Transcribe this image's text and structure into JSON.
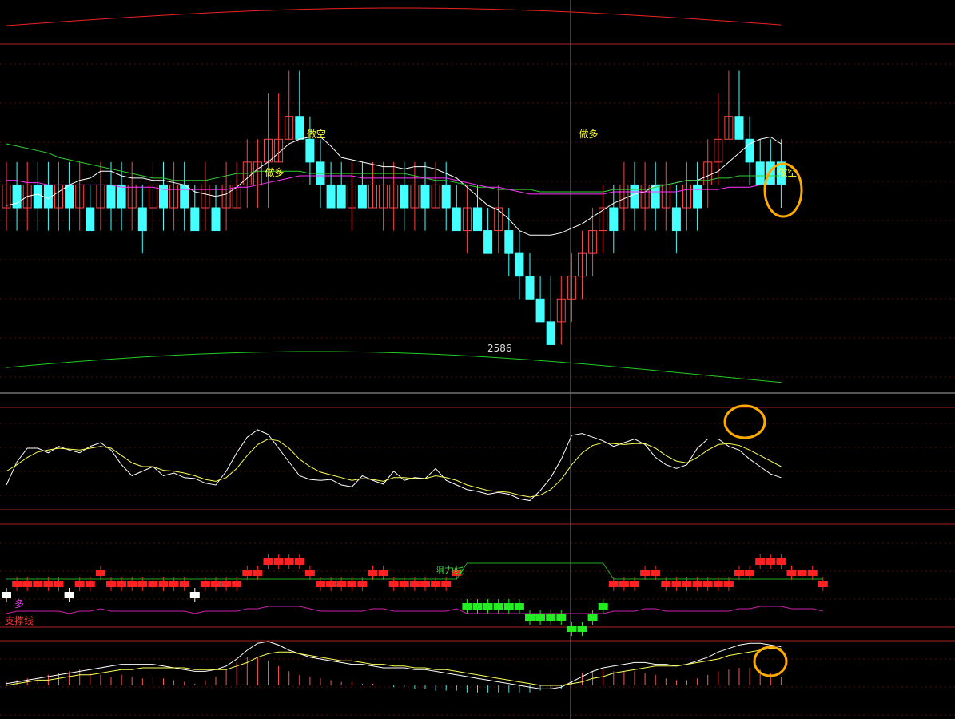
{
  "chart_data": [
    {
      "type": "candlestick",
      "panel": "main",
      "annotations": {
        "low_label": "2586",
        "signals": [
          {
            "text": "做空",
            "bar": 29
          },
          {
            "text": "做多",
            "bar": 25
          },
          {
            "text": "做多",
            "bar": 55
          },
          {
            "text": "做空",
            "bar": 74
          }
        ]
      },
      "candles": [
        [
          3,
          4,
          5,
          2
        ],
        [
          4,
          3,
          5,
          2
        ],
        [
          3,
          4,
          5,
          2
        ],
        [
          4,
          3,
          5,
          2
        ],
        [
          4,
          3,
          5,
          2
        ],
        [
          3,
          4,
          5,
          2
        ],
        [
          4,
          3,
          5,
          2
        ],
        [
          3,
          4,
          5,
          2
        ],
        [
          3,
          2,
          4,
          2
        ],
        [
          3,
          4,
          5,
          2
        ],
        [
          4,
          3,
          5,
          2
        ],
        [
          4,
          3,
          5,
          2
        ],
        [
          3,
          4,
          5,
          2
        ],
        [
          3,
          2,
          4,
          1
        ],
        [
          3,
          4,
          5,
          2
        ],
        [
          4,
          3,
          5,
          2
        ],
        [
          3,
          4,
          5,
          2
        ],
        [
          4,
          3,
          5,
          2
        ],
        [
          3,
          2,
          4,
          2
        ],
        [
          3,
          4,
          5,
          2
        ],
        [
          3,
          2,
          4,
          2
        ],
        [
          3,
          4,
          5,
          2
        ],
        [
          3,
          4,
          5,
          3
        ],
        [
          4,
          5,
          6,
          3
        ],
        [
          4,
          5,
          6,
          3
        ],
        [
          5,
          6,
          8,
          3
        ],
        [
          5,
          6,
          8,
          5
        ],
        [
          6,
          7,
          9,
          6
        ],
        [
          7,
          6,
          9,
          6
        ],
        [
          6,
          5,
          7,
          4
        ],
        [
          5,
          4,
          6,
          3
        ],
        [
          4,
          3,
          5,
          3
        ],
        [
          4,
          3,
          5,
          3
        ],
        [
          3,
          4,
          5,
          2
        ],
        [
          4,
          3,
          5,
          3
        ],
        [
          3,
          4,
          5,
          3
        ],
        [
          3,
          4,
          5,
          2
        ],
        [
          3,
          4,
          5,
          2
        ],
        [
          4,
          3,
          5,
          2
        ],
        [
          3,
          4,
          5,
          2
        ],
        [
          4,
          3,
          5,
          2
        ],
        [
          3,
          4,
          5,
          3
        ],
        [
          4,
          3,
          5,
          2
        ],
        [
          3,
          2,
          4,
          2
        ],
        [
          2,
          3,
          4,
          1
        ],
        [
          3,
          2,
          4,
          2
        ],
        [
          2,
          1,
          3,
          1
        ],
        [
          2,
          3,
          4,
          1
        ],
        [
          2,
          1,
          3,
          0
        ],
        [
          1,
          0,
          2,
          -1
        ],
        [
          0,
          -1,
          1,
          -1
        ],
        [
          -1,
          -2,
          0,
          -2
        ],
        [
          -2,
          -3,
          0,
          -3
        ],
        [
          -2,
          -1,
          0,
          -3
        ],
        [
          -1,
          0,
          1,
          -2
        ],
        [
          0,
          1,
          2,
          -1
        ],
        [
          1,
          2,
          3,
          0
        ],
        [
          2,
          3,
          4,
          1
        ],
        [
          3,
          2,
          4,
          1
        ],
        [
          3,
          4,
          5,
          2
        ],
        [
          4,
          3,
          5,
          2
        ],
        [
          3,
          4,
          5,
          2
        ],
        [
          4,
          3,
          5,
          2
        ],
        [
          3,
          4,
          5,
          2
        ],
        [
          3,
          2,
          4,
          1
        ],
        [
          3,
          4,
          5,
          2
        ],
        [
          4,
          3,
          5,
          2
        ],
        [
          4,
          5,
          6,
          3
        ],
        [
          5,
          6,
          8,
          4
        ],
        [
          6,
          7,
          9,
          6
        ],
        [
          7,
          6,
          9,
          6
        ],
        [
          6,
          5,
          7,
          4
        ],
        [
          5,
          4,
          6,
          4
        ],
        [
          5,
          4,
          6,
          4
        ],
        [
          5,
          4,
          6,
          3
        ]
      ],
      "low_ylim": [
        -4,
        10
      ],
      "lines": {
        "white": [
          3.1,
          3.2,
          3.5,
          3.6,
          3.4,
          3.7,
          4,
          4.2,
          4.3,
          4.6,
          4.6,
          4.4,
          4.3,
          4.3,
          4.2,
          4.2,
          4.1,
          4,
          3.7,
          3.6,
          3.5,
          3.6,
          3.9,
          4.3,
          4.7,
          5,
          5.4,
          5.8,
          6,
          6.1,
          6.1,
          5.7,
          5.2,
          5.1,
          5,
          4.9,
          4.8,
          4.8,
          4.7,
          4.8,
          4.8,
          4.7,
          4.5,
          4.3,
          3.9,
          3.5,
          3.1,
          2.9,
          2.5,
          2,
          1.8,
          1.8,
          1.8,
          1.9,
          2.1,
          2.3,
          2.6,
          2.9,
          3.2,
          3.4,
          3.6,
          3.7,
          4,
          4,
          4.1,
          4.2,
          4.2,
          4.4,
          4.6,
          5,
          5.4,
          5.8,
          6,
          6.1,
          5.8
        ],
        "green": [
          5.8,
          5.7,
          5.6,
          5.5,
          5.4,
          5.2,
          5.1,
          5,
          4.9,
          4.8,
          4.7,
          4.6,
          4.5,
          4.4,
          4.3,
          4.3,
          4.2,
          4.2,
          4.2,
          4.2,
          4.3,
          4.4,
          4.5,
          4.5,
          4.6,
          4.6,
          4.6,
          4.6,
          4.6,
          4.5,
          4.5,
          4.5,
          4.5,
          4.5,
          4.5,
          4.5,
          4.5,
          4.5,
          4.5,
          4.4,
          4.3,
          4.2,
          4.2,
          4.1,
          4,
          3.9,
          3.9,
          3.8,
          3.8,
          3.8,
          3.8,
          3.7,
          3.7,
          3.7,
          3.7,
          3.7,
          3.7,
          3.7,
          3.8,
          3.8,
          3.8,
          3.8,
          3.9,
          4,
          4.1,
          4.2,
          4.2,
          4.2,
          4.3,
          4.3,
          4.4,
          4.4,
          4.4,
          4.4,
          4.4
        ],
        "magenta": [
          4.2,
          4.2,
          4.1,
          4.1,
          4,
          4,
          4,
          4,
          4,
          4,
          4,
          3.9,
          3.9,
          3.9,
          3.9,
          3.8,
          3.8,
          3.8,
          3.8,
          3.8,
          3.8,
          3.8,
          3.9,
          3.9,
          4,
          4.1,
          4.2,
          4.3,
          4.4,
          4.4,
          4.4,
          4.4,
          4.4,
          4.4,
          4.3,
          4.3,
          4.3,
          4.3,
          4.3,
          4.3,
          4.3,
          4.3,
          4.3,
          4.2,
          4.1,
          4,
          3.9,
          3.9,
          3.8,
          3.7,
          3.6,
          3.6,
          3.6,
          3.6,
          3.6,
          3.6,
          3.6,
          3.6,
          3.7,
          3.7,
          3.7,
          3.7,
          3.7,
          3.7,
          3.7,
          3.8,
          3.8,
          3.8,
          3.8,
          3.9,
          3.9,
          3.9,
          4,
          4,
          4
        ]
      }
    },
    {
      "type": "line",
      "panel": "oscillator-1",
      "ylim": [
        0,
        100
      ],
      "series": [
        {
          "color": "#ffffff",
          "values": [
            20,
            45,
            60,
            60,
            55,
            62,
            58,
            55,
            62,
            66,
            58,
            42,
            30,
            35,
            40,
            30,
            33,
            28,
            27,
            22,
            20,
            35,
            55,
            72,
            80,
            75,
            60,
            45,
            30,
            26,
            25,
            26,
            20,
            18,
            30,
            25,
            21,
            35,
            25,
            28,
            27,
            38,
            25,
            20,
            15,
            13,
            10,
            12,
            10,
            5,
            3,
            14,
            28,
            48,
            74,
            76,
            72,
            68,
            62,
            66,
            70,
            64,
            50,
            42,
            38,
            42,
            60,
            70,
            70,
            62,
            58,
            48,
            40,
            32,
            28
          ]
        },
        {
          "color": "#ffff55",
          "values": [
            35,
            42,
            50,
            56,
            58,
            60,
            59,
            58,
            60,
            62,
            60,
            52,
            44,
            40,
            40,
            36,
            35,
            33,
            30,
            26,
            24,
            28,
            38,
            52,
            64,
            70,
            68,
            60,
            48,
            40,
            34,
            31,
            28,
            25,
            27,
            26,
            24,
            28,
            28,
            27,
            27,
            30,
            28,
            25,
            20,
            17,
            14,
            13,
            12,
            9,
            7,
            9,
            15,
            26,
            42,
            55,
            63,
            66,
            65,
            64,
            65,
            65,
            60,
            52,
            46,
            44,
            50,
            58,
            64,
            65,
            63,
            58,
            52,
            46,
            40
          ]
        }
      ]
    },
    {
      "type": "bar",
      "panel": "strength",
      "labels": {
        "resistance": "阻力线",
        "support": "支撑线",
        "long_short": "多"
      },
      "ylim": [
        -3,
        4
      ],
      "values": [
        0,
        1,
        1,
        1,
        1,
        1,
        0,
        1,
        1,
        2,
        1,
        1,
        1,
        1,
        1,
        1,
        1,
        1,
        0,
        1,
        1,
        1,
        1,
        2,
        2,
        3,
        3,
        3,
        3,
        2,
        1,
        1,
        1,
        1,
        1,
        2,
        2,
        1,
        1,
        1,
        1,
        1,
        1,
        2,
        -1,
        -1,
        -1,
        -1,
        -1,
        -1,
        -2,
        -2,
        -2,
        -2,
        -3,
        -3,
        -2,
        -1,
        1,
        1,
        1,
        2,
        2,
        1,
        1,
        1,
        1,
        1,
        1,
        1,
        2,
        2,
        3,
        3,
        3,
        2,
        2,
        2,
        1
      ]
    },
    {
      "type": "bar",
      "panel": "macd",
      "ylim": [
        -2,
        3
      ],
      "series": [
        {
          "color": "#ffffff",
          "values": [
            0.1,
            0.2,
            0.3,
            0.4,
            0.5,
            0.6,
            0.7,
            0.8,
            0.9,
            1,
            1.1,
            1.2,
            1.2,
            1.2,
            1.2,
            1.1,
            1,
            0.9,
            0.8,
            0.8,
            0.9,
            1.1,
            1.5,
            2,
            2.4,
            2.5,
            2.3,
            2,
            1.8,
            1.6,
            1.5,
            1.4,
            1.3,
            1.2,
            1.2,
            1.1,
            1,
            1,
            1,
            0.9,
            0.9,
            0.8,
            0.7,
            0.6,
            0.5,
            0.4,
            0.3,
            0.2,
            0.1,
            0,
            -0.1,
            -0.2,
            -0.2,
            -0.1,
            0.2,
            0.5,
            0.8,
            1,
            1.1,
            1.2,
            1.3,
            1.3,
            1.2,
            1.2,
            1.1,
            1.2,
            1.4,
            1.6,
            1.9,
            2.1,
            2.3,
            2.4,
            2.4,
            2.3,
            2.2
          ]
        },
        {
          "color": "#ffff55",
          "values": [
            0,
            0.1,
            0.2,
            0.3,
            0.3,
            0.4,
            0.5,
            0.6,
            0.6,
            0.7,
            0.8,
            0.9,
            0.9,
            1,
            1,
            1,
            1,
            1,
            0.9,
            0.9,
            0.9,
            0.9,
            1.1,
            1.3,
            1.6,
            1.8,
            1.9,
            1.9,
            1.8,
            1.7,
            1.6,
            1.5,
            1.4,
            1.4,
            1.3,
            1.2,
            1.2,
            1.1,
            1.1,
            1,
            1,
            0.9,
            0.9,
            0.8,
            0.7,
            0.6,
            0.5,
            0.4,
            0.3,
            0.2,
            0.1,
            0,
            0,
            0,
            0.1,
            0.2,
            0.4,
            0.5,
            0.7,
            0.8,
            0.9,
            1,
            1.1,
            1.1,
            1.1,
            1.2,
            1.3,
            1.4,
            1.5,
            1.7,
            1.8,
            1.9,
            2,
            2.1,
            2.1
          ]
        },
        {
          "color": "#ff5555",
          "values": [
            0.2,
            0.3,
            0.4,
            0.5,
            0.6,
            0.7,
            0.8,
            0.9,
            0.7,
            0.6,
            0.5,
            0.6,
            0.5,
            0.4,
            0.5,
            0.4,
            0.3,
            0.2,
            0.1,
            0.3,
            0.5,
            0.9,
            1.3,
            1.6,
            1.6,
            1.4,
            1.1,
            0.8,
            0.6,
            0.5,
            0.4,
            0.3,
            0.2,
            0.2,
            0.1,
            0.1,
            0,
            -0.1,
            -0.1,
            -0.2,
            -0.2,
            -0.3,
            -0.3,
            -0.3,
            -0.4,
            -0.4,
            -0.4,
            -0.4,
            -0.4,
            -0.4,
            -0.4,
            -0.3,
            -0.2,
            -0.2,
            0.2,
            0.7,
            0.8,
            0.9,
            0.8,
            0.8,
            0.8,
            0.7,
            0.6,
            0.4,
            0.3,
            0.3,
            0.4,
            0.6,
            0.8,
            0.9,
            1,
            1,
            0.9,
            0.7,
            0.5
          ]
        }
      ]
    }
  ]
}
